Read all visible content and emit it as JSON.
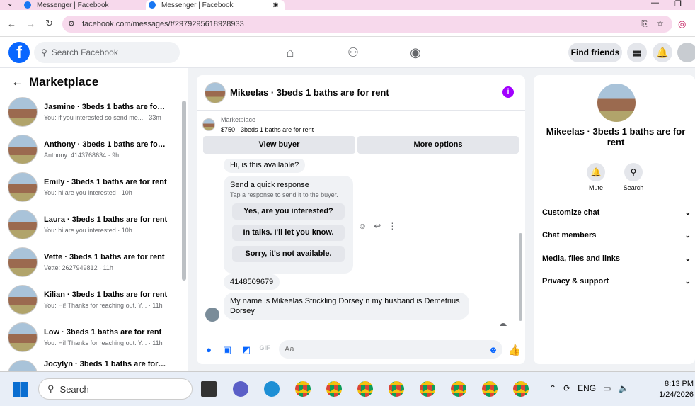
{
  "browser": {
    "tabs": [
      {
        "label": "Messenger | Facebook"
      },
      {
        "label": "Messenger | Facebook"
      }
    ],
    "url": "facebook.com/messages/t/2979295618928933"
  },
  "header": {
    "search_placeholder": "Search Facebook",
    "find_friends": "Find friends"
  },
  "sidebar": {
    "title": "Marketplace",
    "conversations": [
      {
        "title": "Jasmine · 3beds 1 baths are for r...",
        "snippet": "You: if you interested so send me... · 33m"
      },
      {
        "title": "Anthony · 3beds 1 baths are for ...",
        "snippet": "Anthony: 4143768634 · 9h"
      },
      {
        "title": "Emily · 3beds 1 baths are for rent",
        "snippet": "You: hi are you interested · 10h"
      },
      {
        "title": "Laura · 3beds 1 baths are for rent",
        "snippet": "You: hi are you interested · 10h"
      },
      {
        "title": "Vette · 3beds 1 baths are for rent",
        "snippet": "Vette: 2627949812 · 11h"
      },
      {
        "title": "Kilian · 3beds 1 baths are for rent",
        "snippet": "You: Hi! Thanks for reaching out. Y... · 11h"
      },
      {
        "title": "Low · 3beds 1 baths are for rent",
        "snippet": "You: Hi! Thanks for reaching out. Y... · 11h"
      },
      {
        "title": "Jocylyn · 3beds 1 baths are for r...",
        "snippet": ""
      }
    ]
  },
  "chat": {
    "title": "Mikeelas · 3beds 1 baths are for rent",
    "marketplace_label": "Marketplace",
    "listing": "$750 · 3beds 1 baths are for rent",
    "view_buyer": "View buyer",
    "more_options": "More options",
    "messages": {
      "m1": "Hi, is this available?",
      "quick_title": "Send a quick response",
      "quick_sub": "Tap a response to send it to the buyer.",
      "q1": "Yes, are you interested?",
      "q2": "In talks. I'll let you know.",
      "q3": "Sorry, it's not available.",
      "m2": "4148509679",
      "m3": "My name is Mikeelas Strickling Dorsey n my husband is Demetrius Dorsey"
    },
    "composer_placeholder": "Aa"
  },
  "details": {
    "name": "Mikeelas · 3beds 1 baths are for rent",
    "mute": "Mute",
    "search": "Search",
    "sections": [
      "Customize chat",
      "Chat members",
      "Media, files and links",
      "Privacy & support"
    ]
  },
  "taskbar": {
    "search": "Search",
    "lang": "ENG",
    "time": "8:13 PM",
    "date": "1/24/2026"
  },
  "colors": {
    "accent": "#0866ff",
    "info": "#a100ff"
  }
}
